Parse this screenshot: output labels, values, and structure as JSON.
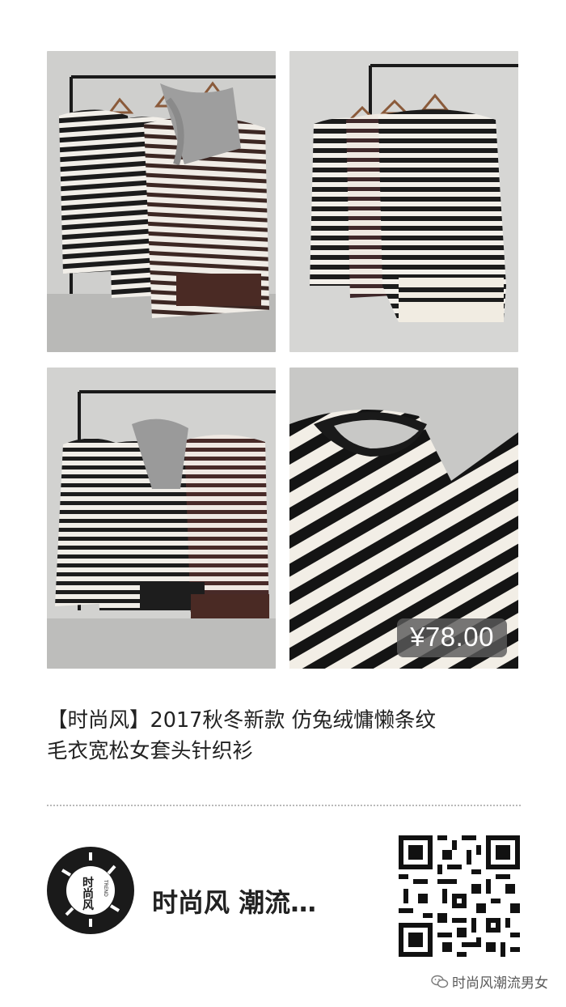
{
  "product": {
    "price": "¥78.00",
    "title_line1": "【时尚风】2017秋冬新款 仿兔绒慵懒条纹",
    "title_line2": "毛衣宽松女套头针织衫"
  },
  "shop": {
    "name": "时尚风 潮流…",
    "logo_text": "时尚风",
    "logo_trend": "TREND"
  },
  "footer": {
    "source_label": "时尚风潮流男女",
    "source_icon": "wechat-icon"
  },
  "photos": [
    {
      "name": "photo-hanger-scarf",
      "alt": "striped sweaters on rack with grey scarf"
    },
    {
      "name": "photo-three-sweaters",
      "alt": "three striped sweaters on hangers"
    },
    {
      "name": "photo-rack-tassel-scarf",
      "alt": "sweaters on rack with tassel scarf"
    },
    {
      "name": "photo-closeup",
      "alt": "close-up of striped knit sweater"
    }
  ]
}
